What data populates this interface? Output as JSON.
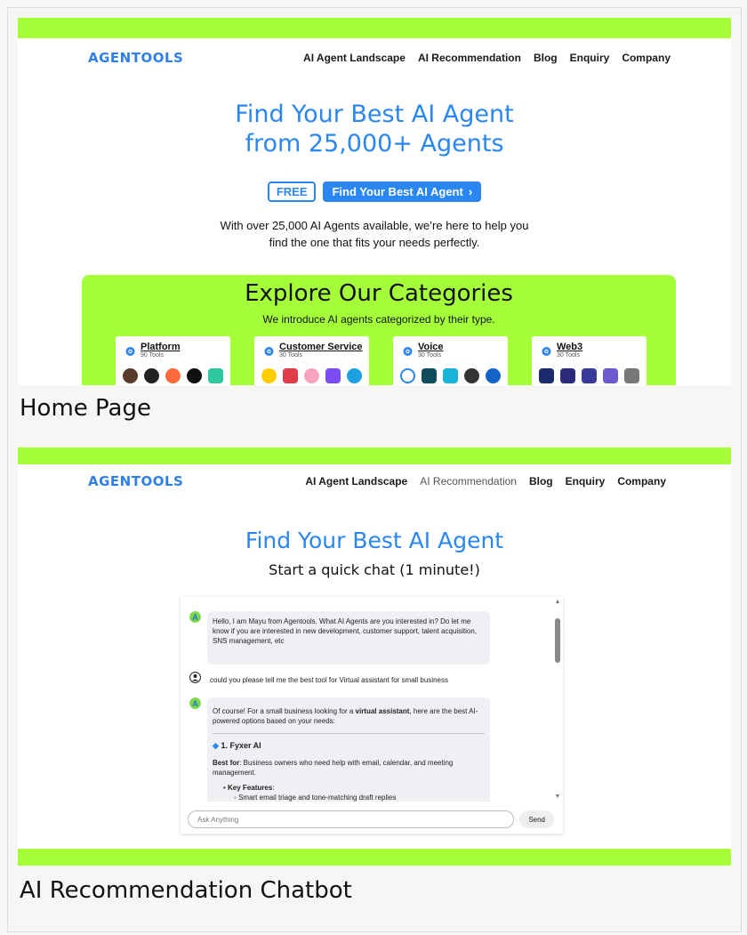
{
  "home": {
    "logo": "AGENTOOLS",
    "nav": [
      "AI Agent Landscape",
      "AI Recommendation",
      "Blog",
      "Enquiry",
      "Company"
    ],
    "hero_title_1": "Find Your Best AI Agent",
    "hero_title_2": "from 25,000+ Agents",
    "free_badge": "FREE",
    "cta_label": "Find Your Best AI Agent",
    "cta_chevron": "›",
    "desc_1": "With over 25,000 AI Agents available, we’re here to help you",
    "desc_2": "find the one that fits your needs perfectly.",
    "categories_title": "Explore Our Categories",
    "categories_sub": "We introduce AI agents categorized by their type.",
    "cards": [
      {
        "name": "Platform",
        "count": "90 Tools"
      },
      {
        "name": "Customer Service",
        "count": "30 Tools"
      },
      {
        "name": "Voice",
        "count": "30 Tools"
      },
      {
        "name": "Web3",
        "count": "30 Tools"
      }
    ],
    "caption": "Home Page"
  },
  "chatbot": {
    "logo": "AGENTOOLS",
    "nav": [
      "AI Agent Landscape",
      "AI Recommendation",
      "Blog",
      "Enquiry",
      "Company"
    ],
    "title": "Find Your Best AI Agent",
    "subtitle": "Start a quick chat (1 minute!)",
    "messages": {
      "bot_1": "Hello, I am Mayu from Agentools. What AI Agents are you interested in? Do let me know if you are interested in new development, customer support, talent acquisition, SNS management, etc",
      "user_1": "could you please tell me the best tool for Virtual assistant for small business",
      "bot_2_pre": "Of course! For a small business looking for a ",
      "bot_2_bold": "virtual assistant",
      "bot_2_post": ", here are the best AI-powered options based on your needs:",
      "bot_2_heading": "1. Fyxer AI",
      "bot_2_bestfor_label": "Best for",
      "bot_2_bestfor": ": Business owners who need help with email, calendar, and meeting management.",
      "bot_2_keyfeatures": "Key Features",
      "bot_2_feature_1": "Smart email triage and tone-matching draft replies"
    },
    "input_placeholder": "Ask Anything",
    "send_label": "Send",
    "caption": "AI Recommendation Chatbot"
  },
  "colors": {
    "accent_green": "#a4ff3a",
    "brand_blue": "#2a86f0"
  }
}
